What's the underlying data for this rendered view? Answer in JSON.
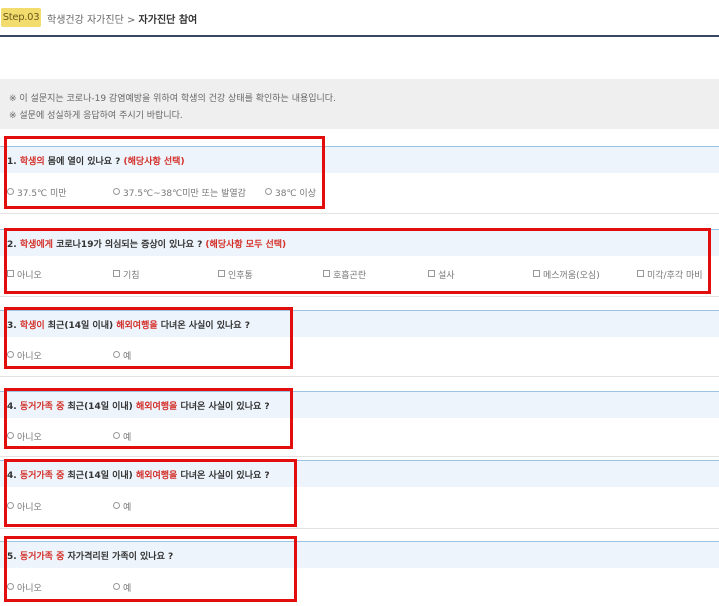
{
  "header": {
    "step_badge": "Step.03",
    "breadcrumb_parent": "학생건강 자가진단",
    "breadcrumb_sep": ">",
    "breadcrumb_current": "자가진단 참여"
  },
  "notice": {
    "lines": [
      "※ 이 설문지는 코로나-19 감염예방을 위하여 학생의 건강 상태를 확인하는 내용입니다.",
      "※ 설문에 성실하게 응답하여 주시기 바랍니다."
    ]
  },
  "questions": [
    {
      "parts": [
        "1. ",
        "학생의",
        " 몸에 열이 있나요 ? ",
        "(해당사항 선택)"
      ],
      "options": [
        "37.5℃ 미만",
        "37.5℃~38℃미만 또는 발열감",
        "38℃ 이상"
      ]
    },
    {
      "parts": [
        "2. ",
        "학생에게",
        " 코로나19가 의심되는 증상이 있나요 ? ",
        "(해당사항 모두 선택)"
      ],
      "options": [
        "아니오",
        "기침",
        "인후통",
        "호흡곤란",
        "설사",
        "메스꺼움(오심)",
        "미각/후각 마비"
      ]
    },
    {
      "parts": [
        "3. ",
        "학생이",
        " 최근(14일 이내) ",
        "해외여행을",
        " 다녀온 사실이 있나요 ?"
      ],
      "options": [
        "아니오",
        "예"
      ]
    },
    {
      "parts": [
        "4. ",
        "동거가족 중",
        " 최근(14일 이내) ",
        "해외여행을",
        " 다녀온 사실이 있나요 ?"
      ],
      "options": [
        "아니오",
        "예"
      ]
    },
    {
      "parts": [
        "4. ",
        "동거가족 중",
        " 최근(14일 이내) ",
        "해외여행을",
        " 다녀온 사실이 있나요 ?"
      ],
      "options": [
        "아니오",
        "예"
      ]
    },
    {
      "parts": [
        "5. ",
        "동거가족 중",
        " 자가격리된 가족이 있나요 ?"
      ],
      "options": [
        "아니오",
        "예"
      ]
    }
  ],
  "colors": {
    "highlight_red": "#d4302a",
    "frame_red": "#e20e0e",
    "badge_yellow": "#f3dc6e",
    "header_line": "#384862",
    "question_band": "#edf4fb"
  }
}
